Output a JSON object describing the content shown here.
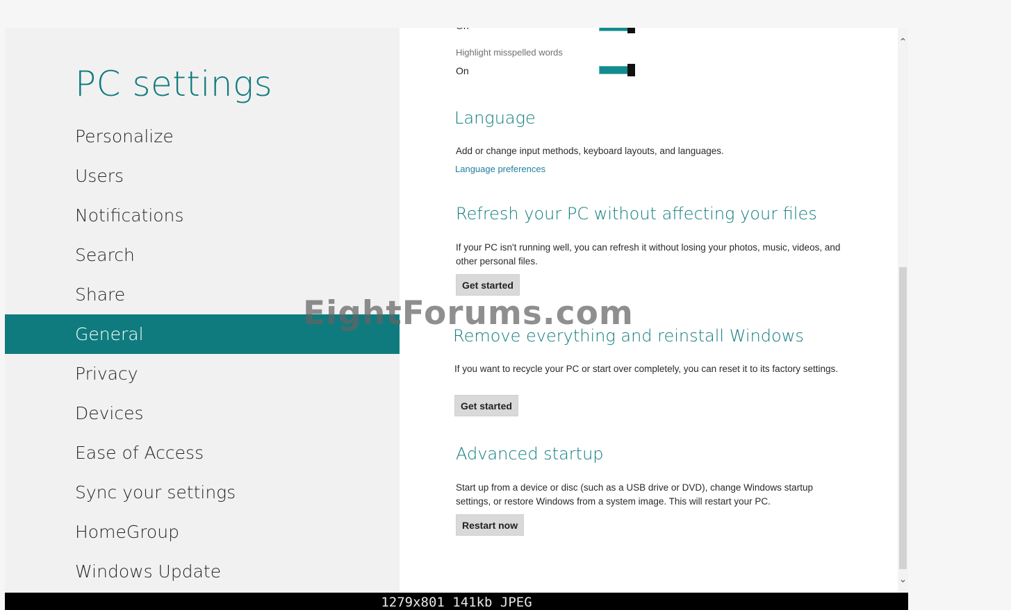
{
  "app": {
    "title": "PC settings"
  },
  "sidebar": {
    "items": [
      {
        "label": "Personalize"
      },
      {
        "label": "Users"
      },
      {
        "label": "Notifications"
      },
      {
        "label": "Search"
      },
      {
        "label": "Share"
      },
      {
        "label": "General",
        "selected": true
      },
      {
        "label": "Privacy"
      },
      {
        "label": "Devices"
      },
      {
        "label": "Ease of Access"
      },
      {
        "label": "Sync your settings"
      },
      {
        "label": "HomeGroup"
      },
      {
        "label": "Windows Update"
      }
    ]
  },
  "main": {
    "partial_toggle": {
      "value": "On",
      "state": true
    },
    "highlight_misspelled": {
      "label": "Highlight misspelled words",
      "value": "On",
      "state": true
    },
    "language": {
      "title": "Language",
      "description": "Add or change input methods, keyboard layouts, and languages.",
      "link": "Language preferences"
    },
    "refresh": {
      "title": "Refresh your PC without affecting your files",
      "description": "If your PC isn't running well, you can refresh it without losing your photos, music, videos, and other personal files.",
      "button": "Get started"
    },
    "reset": {
      "title": "Remove everything and reinstall Windows",
      "description": "If you want to recycle your PC or start over completely, you can reset it to its factory settings.",
      "button": "Get started"
    },
    "advanced": {
      "title": "Advanced startup",
      "description": "Start up from a device or disc (such as a USB drive or DVD), change Windows startup settings, or restore Windows from a system image. This will restart your PC.",
      "button": "Restart now"
    }
  },
  "watermark": "EightForums.com",
  "info_bar": "1279x801 141kb JPEG",
  "colors": {
    "accent": "#0f7b7e",
    "toggle_on": "#128c8f",
    "link": "#1c7fa0"
  },
  "icons": {
    "scroll_up": "chevron-up-icon",
    "scroll_down": "chevron-down-icon"
  }
}
